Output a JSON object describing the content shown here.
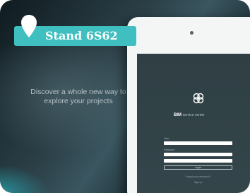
{
  "badge": {
    "text": "Stand 6S62",
    "icon": "map-pin-icon",
    "color": "#3fbfbf"
  },
  "hero": {
    "tagline": "Discover a whole new way to explore your projects"
  },
  "app": {
    "logo_icon": "bim-logo-icon",
    "brand_name": "BIM",
    "brand_suffix": "service center",
    "login_form": {
      "username_label": "User",
      "password_label": "Password",
      "button_label": "Login",
      "forgot_link": "Forgot your password?",
      "footer_link": "Sign up"
    }
  }
}
